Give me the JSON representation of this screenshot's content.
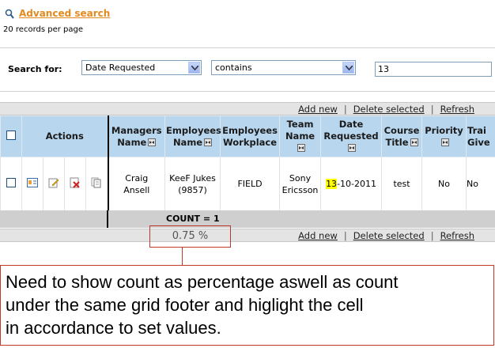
{
  "advanced_search": {
    "label": "Advanced search",
    "icon": "magnifier-icon"
  },
  "records_per_page": "20 records per page",
  "search": {
    "label": "Search for:",
    "field_value": "Date Requested",
    "operator_value": "contains",
    "query_value": "13"
  },
  "toolbar": {
    "add_new": "Add new",
    "delete_selected": "Delete selected",
    "refresh": "Refresh",
    "separator": "|"
  },
  "grid": {
    "headers": {
      "actions": "Actions",
      "managers_name": [
        "Managers",
        "Name"
      ],
      "employees_name": [
        "Employees",
        "Name"
      ],
      "employees_workplace": [
        "Employees",
        "Workplace"
      ],
      "team_name": [
        "Team",
        "Name"
      ],
      "date_requested": [
        "Date",
        "Requested"
      ],
      "course_title": [
        "Course",
        "Title"
      ],
      "priority": "Priority",
      "training_given": [
        "Trai",
        "Give"
      ]
    },
    "row": {
      "managers_name": [
        "Craig",
        "Ansell"
      ],
      "employees_name": [
        "KeeF Jukes",
        "(9857)"
      ],
      "employees_workplace": "FIELD",
      "team_name": [
        "Sony",
        "Ericsson"
      ],
      "date_requested_highlight": "13",
      "date_requested_rest": "-10-2011",
      "course_title": "test",
      "priority": "No",
      "training_given": "No"
    },
    "action_icons": [
      "view-card-icon",
      "edit-icon",
      "delete-icon",
      "copy-icon"
    ]
  },
  "footer": {
    "count": "COUNT = 1",
    "percentage": "0.75 %"
  },
  "note": {
    "lines": [
      "Need to show count as percentage aswell as count",
      "under the same grid footer and higlight the cell",
      "in accordance to set values."
    ]
  },
  "colors": {
    "accent_link": "#e38a1e",
    "grid_header": "#b8d6ee",
    "highlight": "#ffff00",
    "annotation_border": "#c0392b"
  }
}
